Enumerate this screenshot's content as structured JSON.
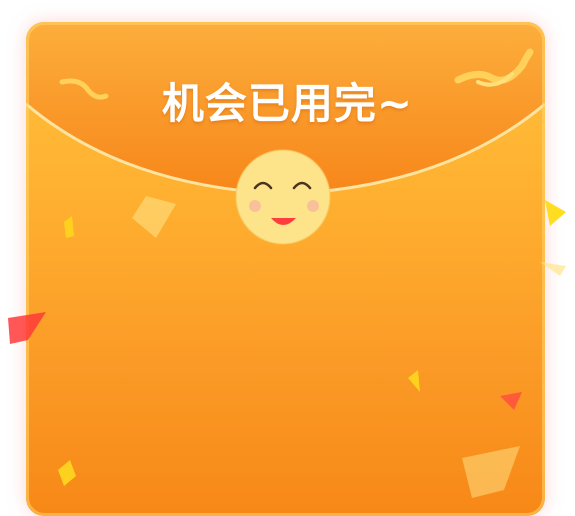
{
  "popup": {
    "title": "机会已用完~"
  },
  "colors": {
    "envelope_top": "#ffc23c",
    "envelope_bottom": "#f78817",
    "flap_top": "#fca83a",
    "flap_bottom": "#f8861a",
    "flap_rim": "#ffe3a0",
    "face": "#fde48a",
    "cheek": "#f7b89e",
    "mouth": "#ff3d3d"
  },
  "icons": {
    "mascot": "smiley-face-icon",
    "ribbon": "ribbon-confetti-icon"
  }
}
